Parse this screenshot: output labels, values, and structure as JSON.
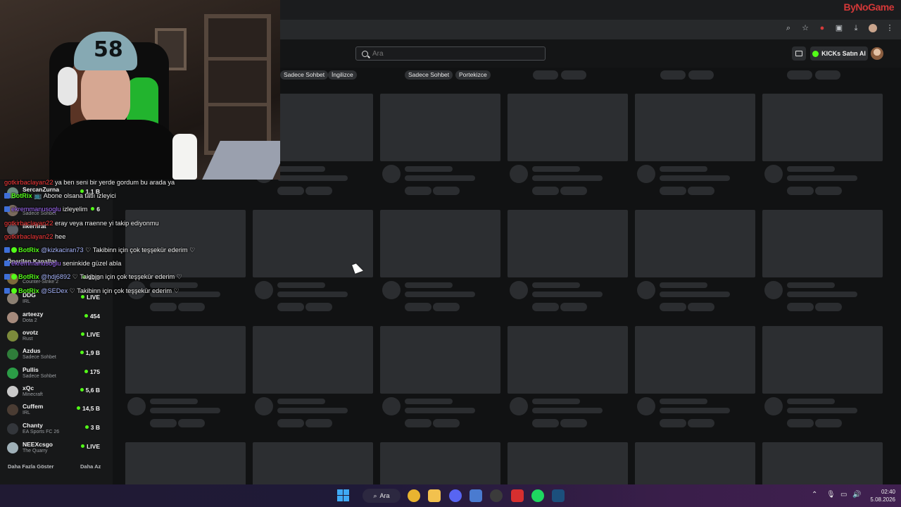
{
  "browser": {
    "brand": "ByNoGame",
    "address_icons": [
      "zoom-icon",
      "star-icon",
      "extension-red-icon",
      "puzzle-icon",
      "download-icon",
      "profile-icon",
      "menu-icon"
    ]
  },
  "header": {
    "search_placeholder": "Ara",
    "kicks_button": "KICKs Satın Al"
  },
  "tags": [
    {
      "label": "Sadece Sohbet"
    },
    {
      "label": "İngilizce"
    },
    {
      "label": "Sadece Sohbet"
    },
    {
      "label": "Portekizce"
    }
  ],
  "sidebar": {
    "channels": [
      {
        "name": "SercanZurna",
        "category": "",
        "count": "1,1 B",
        "color": "#6c8a7d"
      },
      {
        "name": "",
        "category": "Sadece Sohbet",
        "count": "6",
        "color": "#7a6a5d"
      },
      {
        "name": "ilkerfirat",
        "category": "",
        "count": "",
        "color": "#5b5f66"
      },
      {
        "name": "Önerilen Kanallar",
        "category": "",
        "count": "",
        "color": ""
      },
      {
        "name": "",
        "category": "Counter-Strike 2",
        "count": "10,3",
        "color": "#7c6a3b"
      },
      {
        "name": "DDG",
        "category": "IRL",
        "count": "LIVE",
        "color": "#8b7f72"
      },
      {
        "name": "arteezy",
        "category": "Dota 2",
        "count": "454",
        "color": "#a58a7c"
      },
      {
        "name": "ovotz",
        "category": "Rust",
        "count": "LIVE",
        "color": "#7c8a3b"
      },
      {
        "name": "Azdus",
        "category": "Sadece Sohbet",
        "count": "1,9 B",
        "color": "#2f7d3a"
      },
      {
        "name": "Pullis",
        "category": "Sadece Sohbet",
        "count": "175",
        "color": "#2b9c46"
      },
      {
        "name": "xQc",
        "category": "Minecraft",
        "count": "5,6 B",
        "color": "#c9c9c9"
      },
      {
        "name": "Cuffem",
        "category": "IRL",
        "count": "14,5 B",
        "color": "#4a3c33"
      },
      {
        "name": "Chanty",
        "category": "EA Sports FC 26",
        "count": "3 B",
        "color": "#33363b"
      },
      {
        "name": "NEEXcsgo",
        "category": "The Quarry",
        "count": "LIVE",
        "color": "#9fb0b8"
      }
    ],
    "show_more": "Daha Fazla Göster",
    "show_less": "Daha Az"
  },
  "chat": [
    {
      "user": "gotkirbaclayan22",
      "type": "red",
      "badge": "",
      "text": "ya ben seni bir yerde gordum bu arada ya"
    },
    {
      "user": "BotRix",
      "type": "bot",
      "badge": "b",
      "text": "📺 Abone olsana tatlı izleyici"
    },
    {
      "user": "ekremmanusoglu",
      "type": "purple",
      "badge": "b",
      "text": "izleyelim"
    },
    {
      "user": "gotkirbaclayan22",
      "type": "red",
      "badge": "",
      "text": "eray veya rraenne yi takip ediyonmu"
    },
    {
      "user": "gotkirbaclayan22",
      "type": "red",
      "badge": "",
      "text": "hee"
    },
    {
      "user": "BotRix",
      "type": "bot",
      "badge": "bg",
      "mention": "@kizkaciran73",
      "text": "♡ Takibinn için çok teşşekür ederim ♡"
    },
    {
      "user": "ekremmanusoglu",
      "type": "purple",
      "badge": "b",
      "text": "seninkide güzel abla"
    },
    {
      "user": "BotRix",
      "type": "bot",
      "badge": "bg",
      "mention": "@hdj6892",
      "text": "♡ Takibinn için çok teşşekür ederim ♡"
    },
    {
      "user": "BotRix",
      "type": "bot",
      "badge": "bg",
      "mention": "@SEDex",
      "text": "♡ Takibinn için çok teşşekür ederim ♡"
    }
  ],
  "taskbar": {
    "search": "Ara",
    "time": "02:40",
    "date": "5.08.2026",
    "apps": [
      {
        "name": "chrome-icon",
        "color": "#e9b430"
      },
      {
        "name": "file-explorer-icon",
        "color": "#f2c14e"
      },
      {
        "name": "discord-icon",
        "color": "#5865f2"
      },
      {
        "name": "vpn-icon",
        "color": "#4a7bd0"
      },
      {
        "name": "obs-icon",
        "color": "#3b3b3b"
      },
      {
        "name": "red-app-icon",
        "color": "#d62f2f"
      },
      {
        "name": "spotify-icon",
        "color": "#1ed760"
      },
      {
        "name": "steam-icon",
        "color": "#1b4f7c"
      }
    ]
  }
}
